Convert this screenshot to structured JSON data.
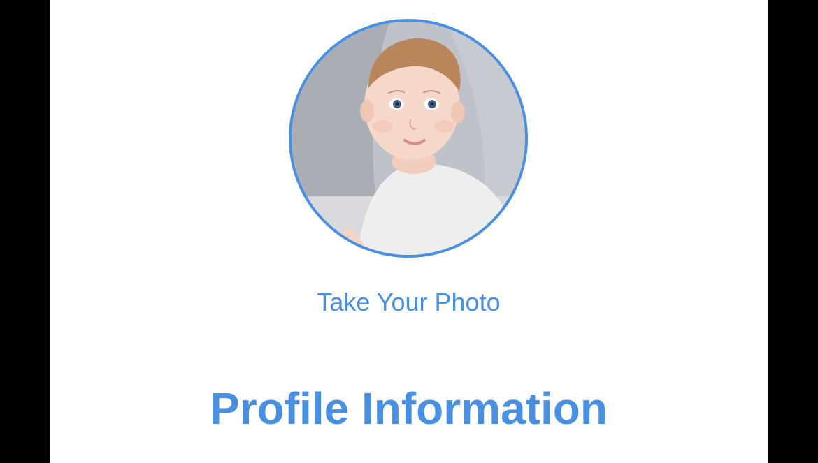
{
  "profile_photo": {
    "icon": "avatar-photo",
    "border_color": "#4a90e2"
  },
  "take_photo_label": "Take Your Photo",
  "section_title": "Profile Information",
  "colors": {
    "accent": "#4a90e2",
    "background": "#ffffff",
    "frame": "#000000"
  }
}
